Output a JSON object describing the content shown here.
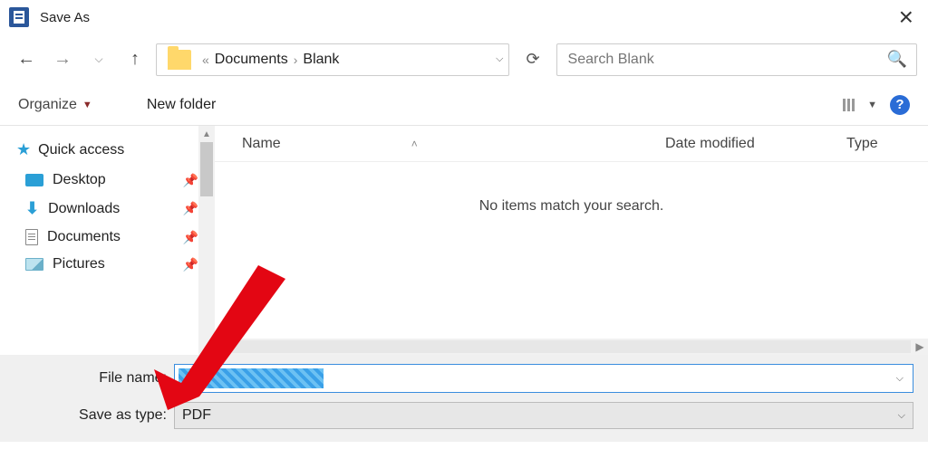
{
  "window": {
    "title": "Save As"
  },
  "breadcrumb": {
    "ellipsis": "«",
    "part1": "Documents",
    "part2": "Blank"
  },
  "search": {
    "placeholder": "Search Blank"
  },
  "toolbar": {
    "organize": "Organize",
    "newfolder": "New folder"
  },
  "sidebar": {
    "header": "Quick access",
    "items": [
      {
        "label": "Desktop"
      },
      {
        "label": "Downloads"
      },
      {
        "label": "Documents"
      },
      {
        "label": "Pictures"
      }
    ]
  },
  "columns": {
    "name": "Name",
    "date": "Date modified",
    "type": "Type"
  },
  "empty_msg": "No items match your search.",
  "file": {
    "name_label": "File name:",
    "type_label": "Save as type:",
    "type_value": "PDF"
  }
}
